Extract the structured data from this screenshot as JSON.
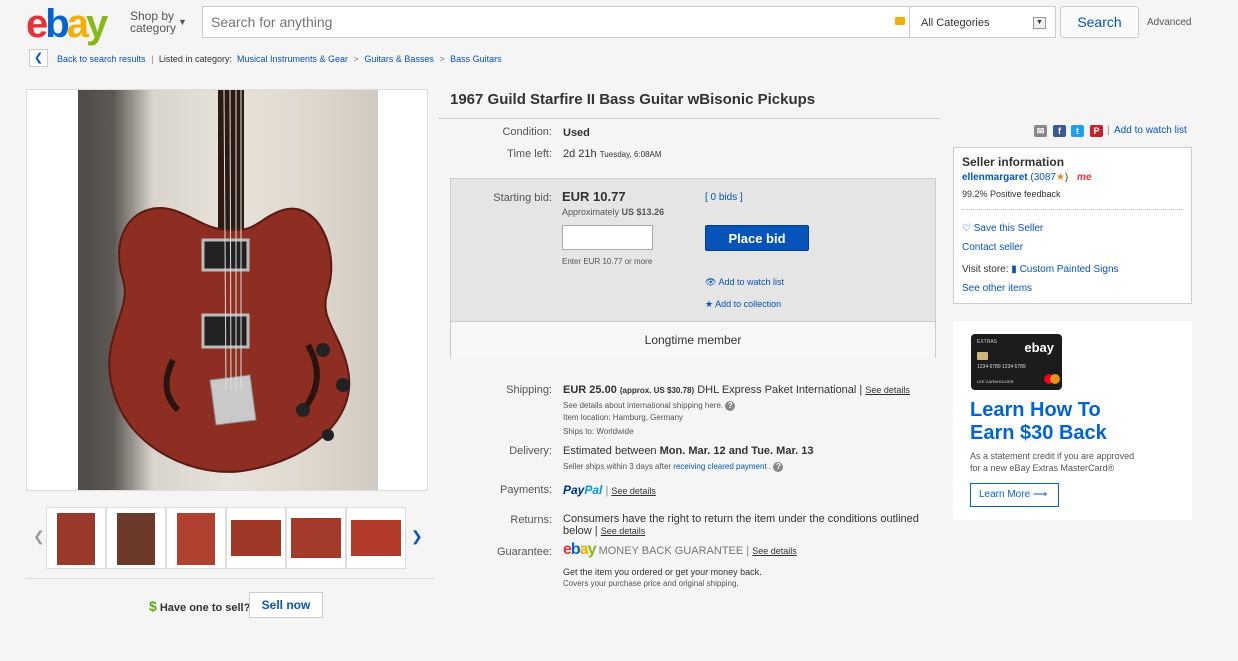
{
  "header": {
    "logo": [
      "e",
      "b",
      "a",
      "y"
    ],
    "shop_by_line1": "Shop by",
    "shop_by_line2": "category",
    "search_placeholder": "Search for anything",
    "category_select": "All Categories",
    "search_button": "Search",
    "advanced": "Advanced"
  },
  "breadcrumb": {
    "back": "Back to search results",
    "listed_in": "Listed in category:",
    "items": [
      "Musical Instruments & Gear",
      "Guitars & Basses",
      "Bass Guitars"
    ]
  },
  "gallery": {
    "thumb_count": 6,
    "sell_prompt": "Have one to sell?",
    "sell_button": "Sell now"
  },
  "item": {
    "title": "1967 Guild Starfire II Bass Guitar wBisonic Pickups",
    "condition_label": "Condition:",
    "condition": "Used",
    "time_left_label": "Time left:",
    "time_left": "2d 21h",
    "time_left_detail": "Tuesday, 6:08AM",
    "add_to_watch": "Add to watch list"
  },
  "bid": {
    "starting_bid_label": "Starting bid:",
    "price": "EUR 10.77",
    "approx_prefix": "Approximately",
    "approx": "US $13.26",
    "bids": "[ 0 bids ]",
    "input_hint": "Enter EUR 10.77 or more",
    "place_bid": "Place bid",
    "watch_list": "Add to watch list",
    "collection": "Add to collection",
    "longtime": "Longtime member"
  },
  "shipping": {
    "label": "Shipping:",
    "price": "EUR 25.00",
    "approx": "(approx. US $30.78)",
    "service": "DHL Express Paket International",
    "see_details": "See details",
    "intl": "See details about international shipping here.",
    "location": "Item location:  Hamburg, Germany",
    "ships_to": "Ships to:  Worldwide"
  },
  "delivery": {
    "label": "Delivery:",
    "prefix": "Estimated between",
    "dates": "Mon. Mar. 12 and Tue. Mar. 13",
    "note_prefix": "Seller ships within 3 days after",
    "note_link": "receiving cleared payment",
    "note_suffix": "."
  },
  "payments": {
    "label": "Payments:",
    "paypal_1": "Pay",
    "paypal_2": "Pal",
    "see_details": "See details"
  },
  "returns": {
    "label": "Returns:",
    "line1": "Consumers have the right to return the item under the conditions outlined",
    "line2": "below |",
    "see_details": "See details"
  },
  "guarantee": {
    "label": "Guarantee:",
    "logo": [
      "e",
      "b",
      "a",
      "y"
    ],
    "text": "MONEY BACK GUARANTEE",
    "see_details": "See details",
    "line1": "Get the item you ordered or get your money back.",
    "line2": "Covers your purchase price and original shipping."
  },
  "seller": {
    "heading": "Seller information",
    "name": "ellenmargaret",
    "score": "(3087",
    "feedback": "99.2% Positive feedback",
    "save": "Save this Seller",
    "contact": "Contact seller",
    "visit_store": "Visit store:",
    "store_name": "Custom Painted Signs",
    "other_items": "See other items",
    "me_badge": "me"
  },
  "ad": {
    "card_brand": "EXTRAS",
    "card_logo": "ebay",
    "card_number": "1234  6789  1234  6789",
    "card_holder": "LEE CARDHOLDER",
    "headline_1": "Learn How To",
    "headline_2": "Earn $30 Back",
    "body_1": "As a statement credit if you are approved",
    "body_2": "for a new eBay Extras MasterCard®",
    "button": "Learn More"
  },
  "colors": {
    "link": "#0654ba",
    "place_bid": "#0654ba",
    "ad_blue": "#0064d2"
  }
}
